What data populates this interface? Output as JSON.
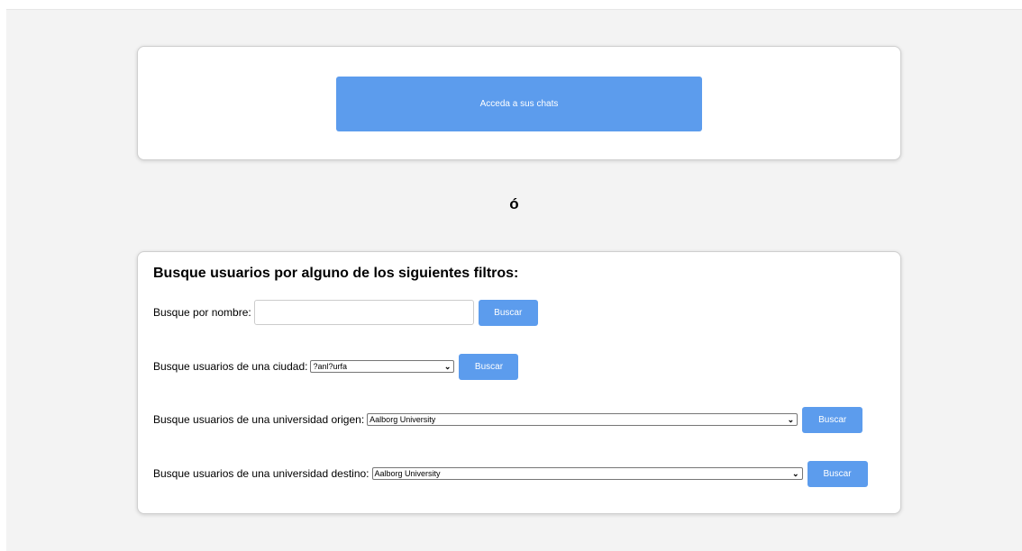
{
  "chats_button_label": "Acceda a sus chats",
  "separator_text": "ó",
  "filters": {
    "title": "Busque usuarios por alguno de los siguientes filtros:",
    "name": {
      "label": "Busque por nombre:",
      "value": "",
      "button_label": "Buscar"
    },
    "city": {
      "label": "Busque usuarios de una ciudad:",
      "selected": "?anl?urfa",
      "button_label": "Buscar"
    },
    "origin_university": {
      "label": "Busque usuarios de una universidad origen:",
      "selected": "Aalborg University",
      "button_label": "Buscar"
    },
    "destination_university": {
      "label": "Busque usuarios de una universidad destino:",
      "selected": "Aalborg University",
      "button_label": "Buscar"
    }
  },
  "colors": {
    "accent": "#5c9ced",
    "background": "#f3f3f3"
  }
}
